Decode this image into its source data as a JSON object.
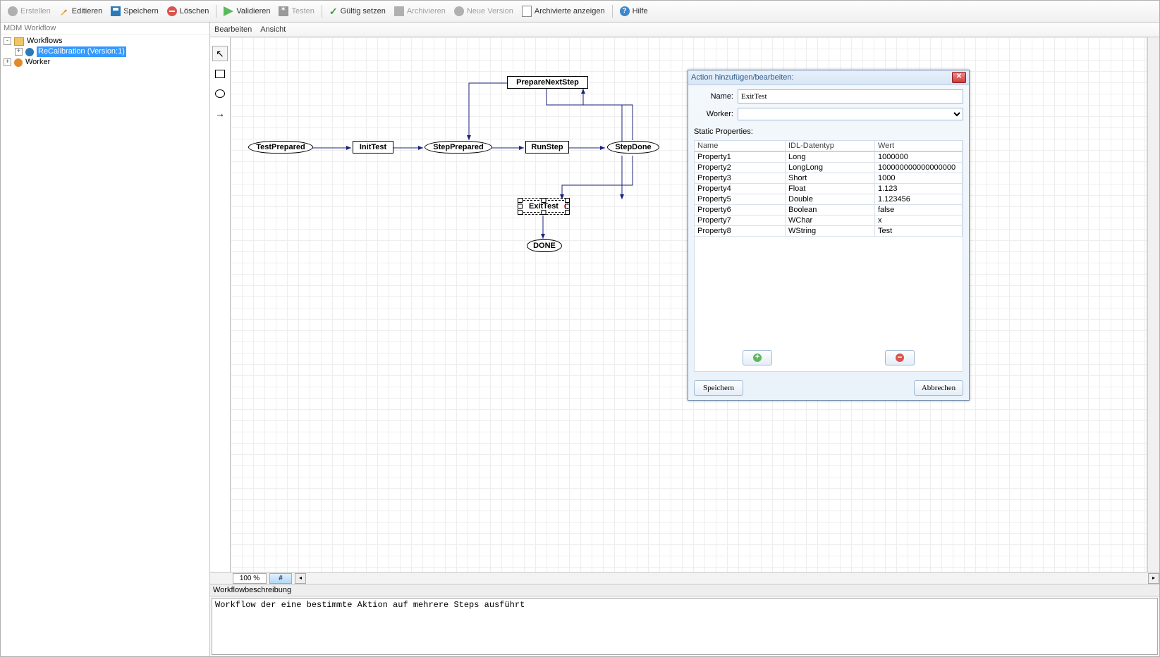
{
  "toolbar": {
    "create": "Erstellen",
    "edit": "Editieren",
    "save": "Speichern",
    "delete": "Löschen",
    "validate": "Validieren",
    "test": "Testen",
    "setvalid": "Gültig setzen",
    "archive": "Archivieren",
    "newversion": "Neue Version",
    "showarchived": "Archivierte anzeigen",
    "help": "Hilfe"
  },
  "sidebar": {
    "title": "MDM Workflow",
    "workflows_label": "Workflows",
    "recalibration_label": "ReCalibration (Version:1)",
    "worker_label": "Worker"
  },
  "editor_menu": {
    "bearbeiten": "Bearbeiten",
    "ansicht": "Ansicht"
  },
  "nodes": {
    "preparenext": "PrepareNextStep",
    "testprepared": "TestPrepared",
    "inittest": "InitTest",
    "stepprepared": "StepPrepared",
    "runstep": "RunStep",
    "stepdone": "StepDone",
    "exittest": "ExitTest",
    "done": "DONE"
  },
  "zoom": {
    "pct": "100 %",
    "ctrl": "#"
  },
  "description": {
    "title": "Workflowbeschreibung",
    "text": "Workflow der eine bestimmte Aktion auf mehrere Steps ausführt"
  },
  "dialog": {
    "title": "Action hinzufügen/bearbeiten:",
    "name_label": "Name:",
    "name_value": "ExitTest",
    "worker_label": "Worker:",
    "worker_value": "",
    "props_label": "Static Properties:",
    "headers": {
      "name": "Name",
      "type": "IDL-Datentyp",
      "value": "Wert"
    },
    "rows": [
      {
        "name": "Property1",
        "type": "Long",
        "value": "1000000"
      },
      {
        "name": "Property2",
        "type": "LongLong",
        "value": "100000000000000000"
      },
      {
        "name": "Property3",
        "type": "Short",
        "value": "1000"
      },
      {
        "name": "Property4",
        "type": "Float",
        "value": "1.123"
      },
      {
        "name": "Property5",
        "type": "Double",
        "value": "1.123456"
      },
      {
        "name": "Property6",
        "type": "Boolean",
        "value": "false"
      },
      {
        "name": "Property7",
        "type": "WChar",
        "value": "x"
      },
      {
        "name": "Property8",
        "type": "WString",
        "value": "Test"
      }
    ],
    "save": "Speichern",
    "cancel": "Abbrechen"
  }
}
